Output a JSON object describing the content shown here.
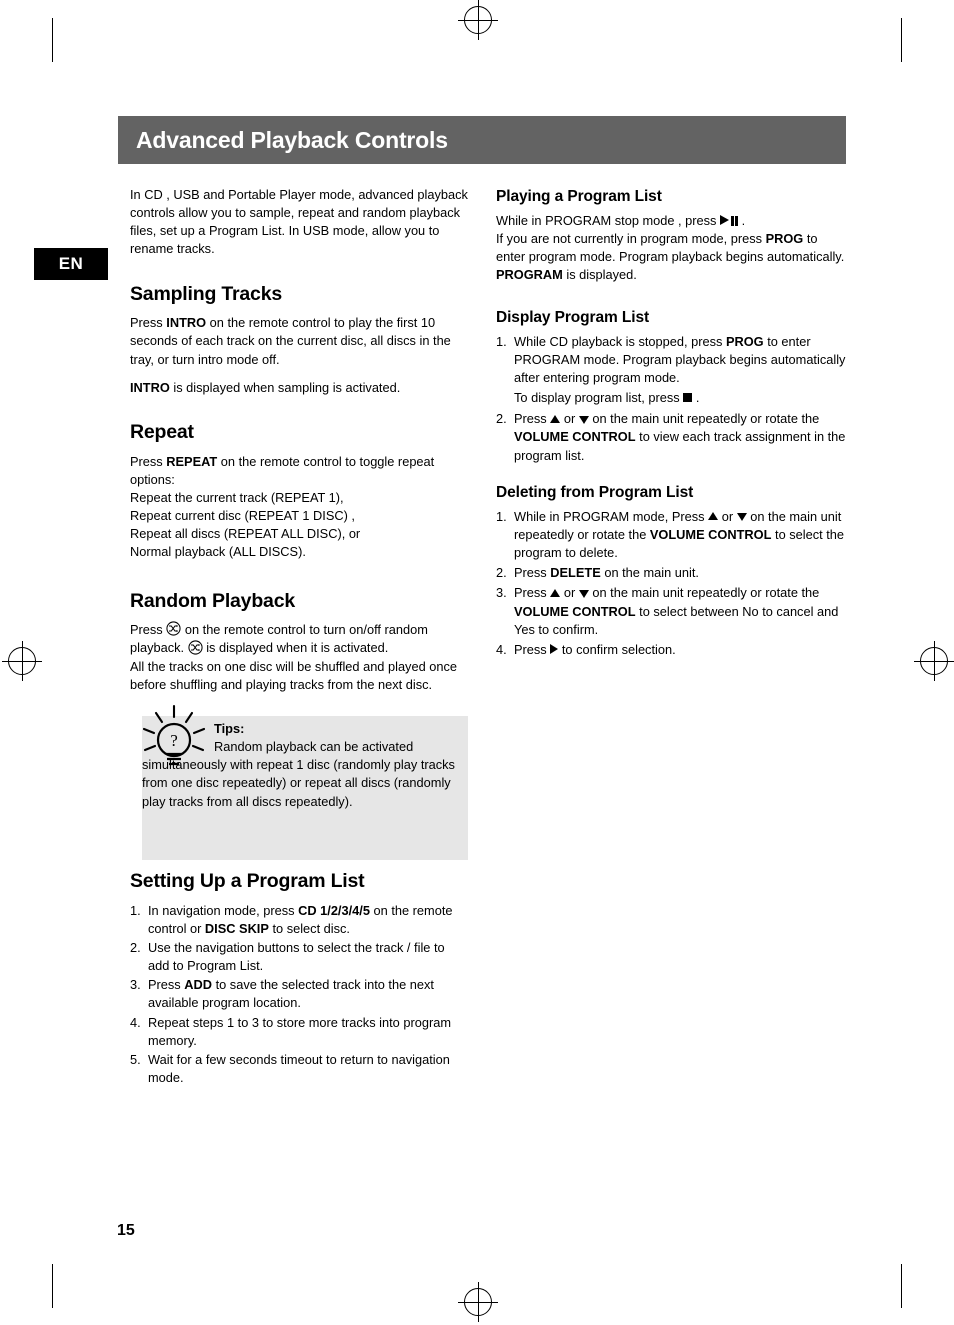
{
  "page": {
    "header_title": "Advanced Playback Controls",
    "language_tab": "EN",
    "page_number": "15"
  },
  "left_column": {
    "intro": "In CD , USB and Portable Player mode, advanced playback controls allow you to sample, repeat and random playback files, set up a Program List. In USB mode, allow you to rename tracks.",
    "sampling": {
      "heading": "Sampling Tracks",
      "p1_a": "Press ",
      "p1_b": "INTRO",
      "p1_c": " on the remote control to play the first 10 seconds of each track on the current disc, all discs in the tray, or turn intro mode off.",
      "p2_a": "INTRO",
      "p2_b": " is displayed when sampling is activated."
    },
    "repeat": {
      "heading": "Repeat",
      "p1_a": "Press ",
      "p1_b": "REPEAT",
      "p1_c": " on the remote control to toggle repeat options:",
      "line2": "Repeat the current track (REPEAT 1),",
      "line3": "Repeat current disc (REPEAT 1 DISC) ,",
      "line4": "Repeat all discs (REPEAT ALL DISC), or",
      "line5": "Normal playback (ALL DISCS)."
    },
    "random": {
      "heading": "Random Playback",
      "p1_a": "Press",
      "p1_b": "on the remote control to turn on/off random playback.",
      "p1_c": "is displayed when it is activated.",
      "p2": "All the tracks on one disc will be shuffled and played once before shuffling and playing tracks from the next disc."
    },
    "tips": {
      "title": "Tips:",
      "line1": "Random playback can be activated",
      "body": "simultaneously with repeat 1 disc (randomly play tracks from one disc repeatedly) or repeat all discs (randomly play tracks from all discs repeatedly)."
    },
    "setting_up": {
      "heading": "Setting Up a Program List",
      "items": [
        {
          "n": "1.",
          "a": "In navigation mode, press ",
          "b": "CD 1/2/3/4/5",
          "c": " on the remote control or ",
          "d": "DISC SKIP",
          "e": " to select disc."
        },
        {
          "n": "2.",
          "a": "Use the navigation buttons to select the track / file to add to Program List.",
          "b": "",
          "c": "",
          "d": "",
          "e": ""
        },
        {
          "n": "3.",
          "a": "Press ",
          "b": "ADD",
          "c": " to save the selected track into the next available program location.",
          "d": "",
          "e": ""
        },
        {
          "n": "4.",
          "a": "Repeat steps 1 to 3 to store more tracks into program memory.",
          "b": "",
          "c": "",
          "d": "",
          "e": ""
        },
        {
          "n": "5.",
          "a": "Wait for a few seconds timeout to return to navigation mode.",
          "b": "",
          "c": "",
          "d": "",
          "e": ""
        }
      ]
    }
  },
  "right_column": {
    "playing_program": {
      "heading": "Playing a Program List",
      "p1_a": "While in PROGRAM stop mode , press",
      "p1_b": ".",
      "p2_a": "If you are not currently in program mode, press ",
      "p2_b": "PROG",
      "p2_c": " to enter program mode. Program playback begins automatically. ",
      "p2_d": "PROGRAM",
      "p2_e": " is displayed."
    },
    "display_program": {
      "heading": "Display Program List",
      "item1_n": "1.",
      "item1_a": "While CD playback is stopped, press ",
      "item1_b": "PROG",
      "item1_c": " to enter PROGRAM mode. Program playback begins automatically after entering program mode.",
      "item1_d": "To display program list, press",
      "item1_e": ".",
      "item2_n": "2.",
      "item2_a": "Press",
      "item2_or": "or",
      "item2_b": "on the main unit  repeatedly or rotate the ",
      "item2_c": "VOLUME CONTROL",
      "item2_d": " to view each track assignment  in the program list."
    },
    "deleting_program": {
      "heading": "Deleting from Program List",
      "item1_n": "1.",
      "item1_a": "While in PROGRAM mode, Press",
      "item1_or": "or",
      "item1_b": "on the main unit repeatedly or rotate the ",
      "item1_c": "VOLUME CONTROL",
      "item1_d": " to select the program to delete.",
      "item2_n": "2.",
      "item2_a": "Press ",
      "item2_b": "DELETE",
      "item2_c": " on the main unit.",
      "item3_n": "3.",
      "item3_a": "Press",
      "item3_or": "or",
      "item3_b": "on the main unit repeatedly or rotate the ",
      "item3_c": "VOLUME CONTROL",
      "item3_d": " to select between No to cancel and Yes to confirm.",
      "item4_n": "4.",
      "item4_a": "Press",
      "item4_b": "to confirm selection."
    }
  }
}
